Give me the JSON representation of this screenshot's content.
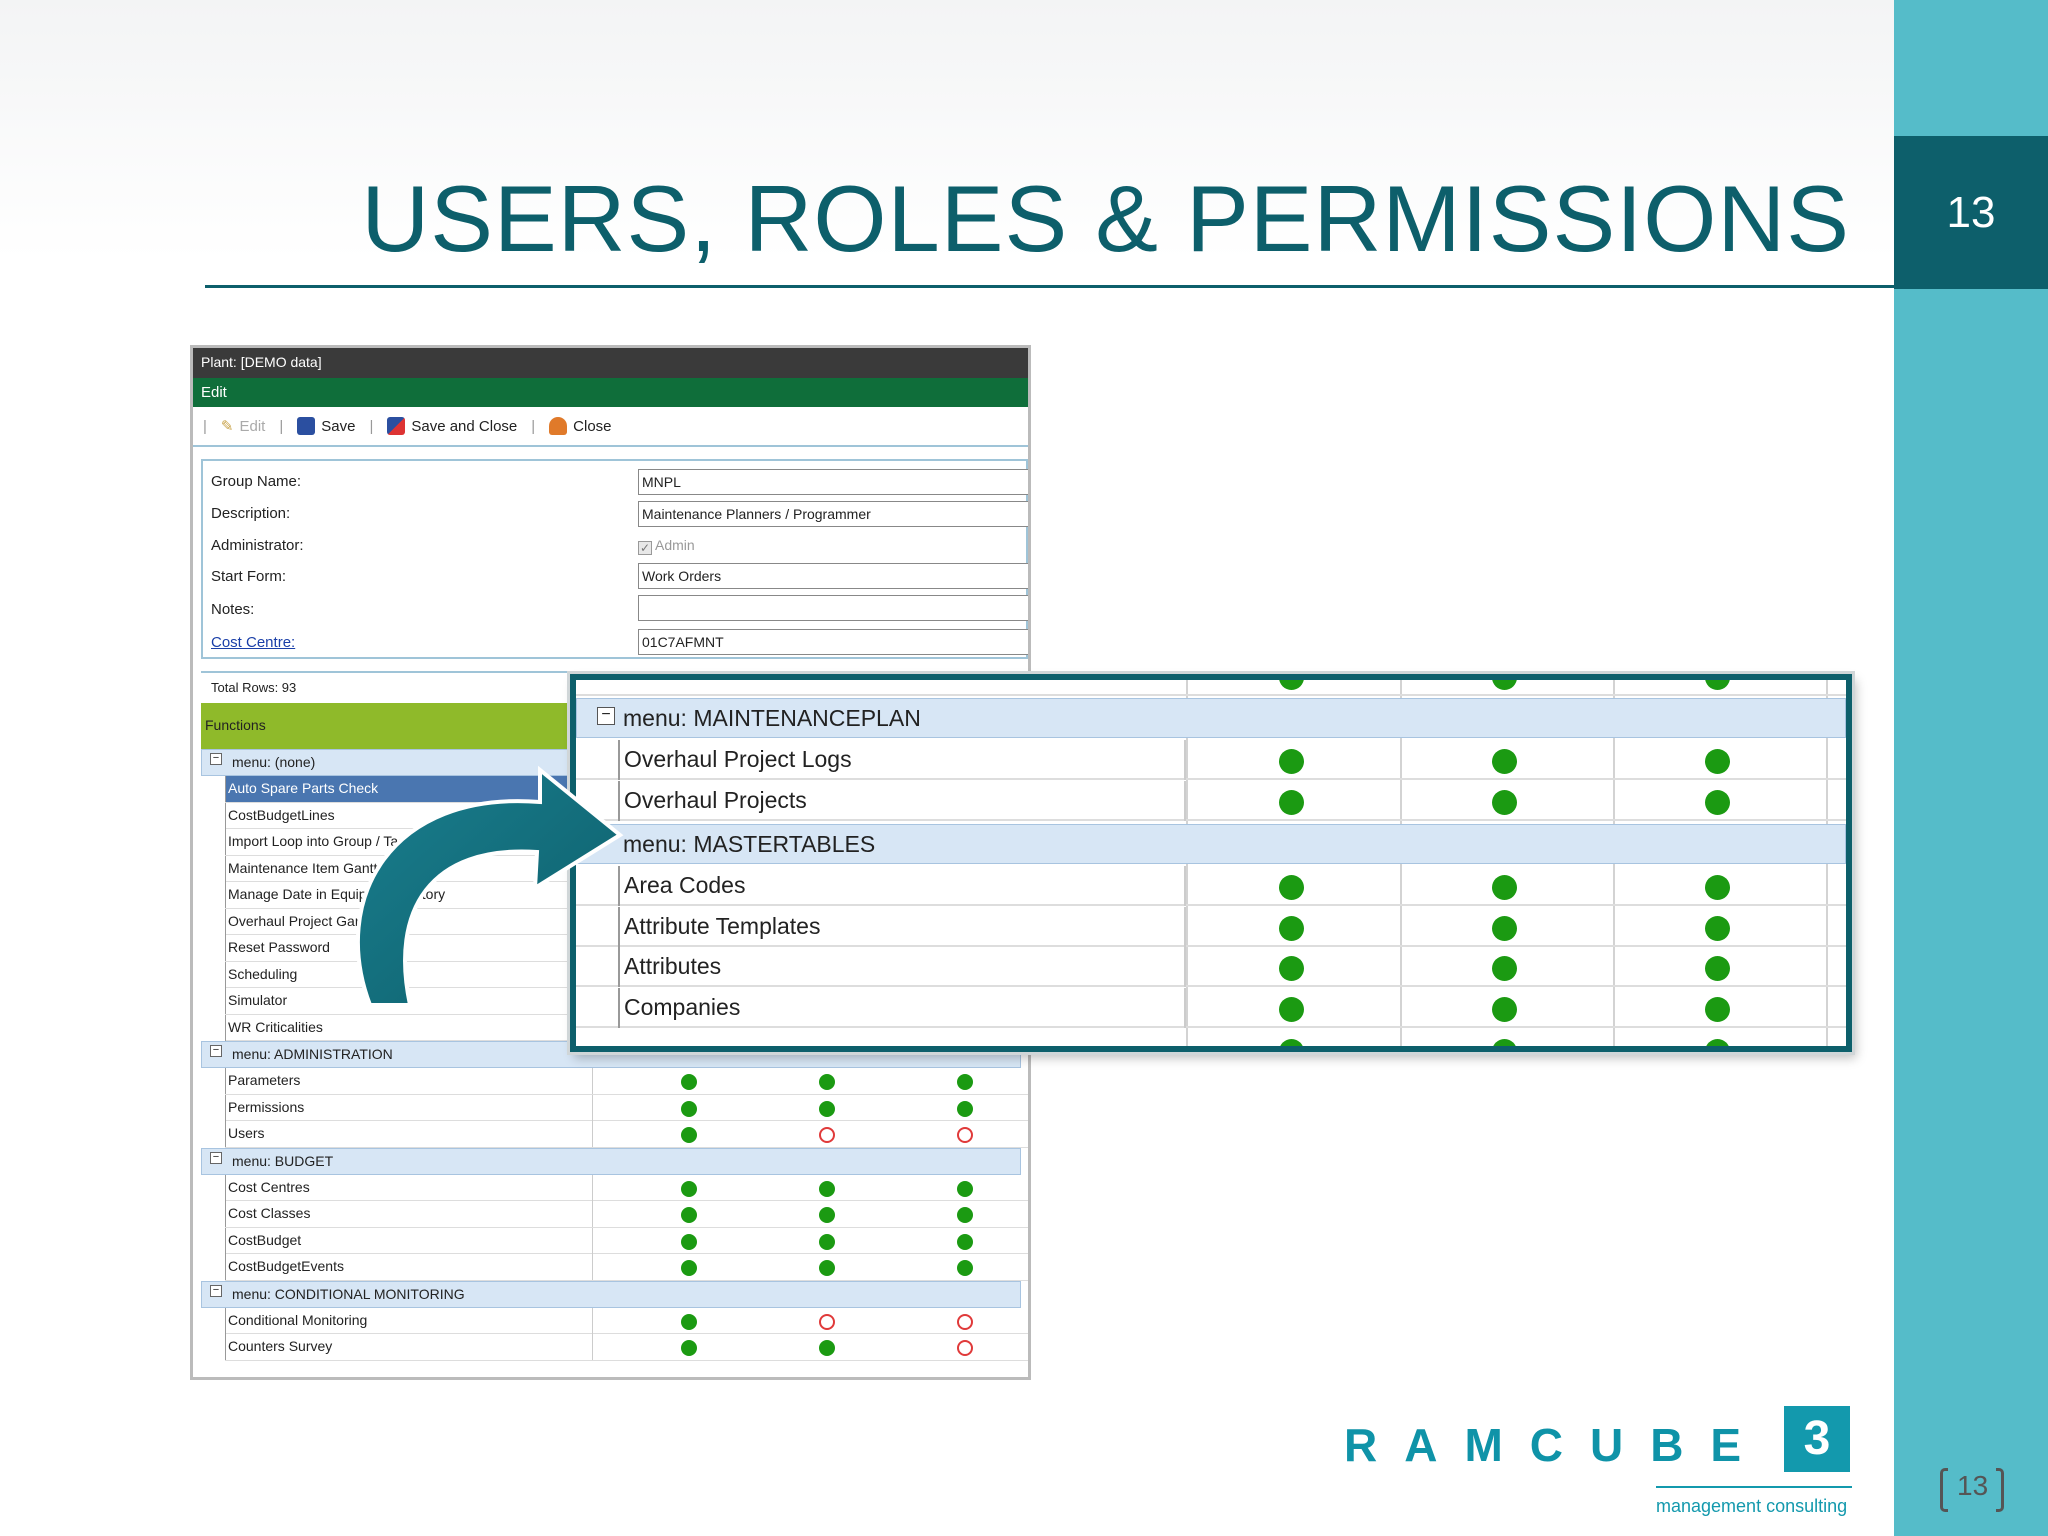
{
  "slide": {
    "title": "USERS, ROLES & PERMISSIONS",
    "page_number": "13",
    "footer_page": "13"
  },
  "logo": {
    "wordmark": "RAMCUBE",
    "mark": "3",
    "tagline": "management consulting"
  },
  "app": {
    "plant_bar": "Plant: [DEMO data]",
    "edit_bar": "Edit",
    "toolbar": {
      "edit": "Edit",
      "save": "Save",
      "save_close": "Save and Close",
      "close": "Close"
    },
    "form": {
      "group_name_label": "Group Name:",
      "group_name_value": "MNPL",
      "description_label": "Description:",
      "description_value": "Maintenance Planners / Programmer",
      "administrator_label": "Administrator:",
      "administrator_value": "Admin",
      "start_form_label": "Start Form:",
      "start_form_value": "Work Orders",
      "notes_label": "Notes:",
      "notes_value": "",
      "cost_centre_label": "Cost Centre:",
      "cost_centre_value": "01C7AFMNT"
    },
    "grid": {
      "total_rows": "Total Rows: 93",
      "functions_header": "Functions",
      "menus": [
        {
          "label": "menu: (none)",
          "rows": [
            {
              "name": "Auto Spare Parts Check",
              "selected": true
            },
            {
              "name": "CostBudgetLines"
            },
            {
              "name": "Import Loop into Group / Tags"
            },
            {
              "name": "Maintenance Item Gantt"
            },
            {
              "name": "Manage Date in Equipment History"
            },
            {
              "name": "Overhaul Project Gantt"
            },
            {
              "name": "Reset Password"
            },
            {
              "name": "Scheduling"
            },
            {
              "name": "Simulator"
            },
            {
              "name": "WR Criticalities"
            }
          ]
        },
        {
          "label": "menu: ADMINISTRATION",
          "rows": [
            {
              "name": "Parameters",
              "perms": [
                true,
                true,
                true
              ]
            },
            {
              "name": "Permissions",
              "perms": [
                true,
                true,
                true
              ]
            },
            {
              "name": "Users",
              "perms": [
                true,
                false,
                false
              ]
            }
          ]
        },
        {
          "label": "menu: BUDGET",
          "rows": [
            {
              "name": "Cost Centres",
              "perms": [
                true,
                true,
                true
              ]
            },
            {
              "name": "Cost Classes",
              "perms": [
                true,
                true,
                true
              ]
            },
            {
              "name": "CostBudget",
              "perms": [
                true,
                true,
                true
              ]
            },
            {
              "name": "CostBudgetEvents",
              "perms": [
                true,
                true,
                true
              ]
            }
          ]
        },
        {
          "label": "menu: CONDITIONAL MONITORING",
          "rows": [
            {
              "name": "Conditional Monitoring",
              "perms": [
                true,
                false,
                false
              ]
            },
            {
              "name": "Counters Survey",
              "perms": [
                true,
                true,
                false
              ]
            }
          ]
        }
      ]
    }
  },
  "zoom": {
    "menu_maintenanceplan": "menu: MAINTENANCEPLAN",
    "menu_mastertables": "menu: MASTERTABLES",
    "maintenance_rows": [
      "Overhaul Project Logs",
      "Overhaul Projects"
    ],
    "master_rows": [
      "Area Codes",
      "Attribute Templates",
      "Attributes",
      "Companies"
    ]
  },
  "colors": {
    "brand_dark": "#0d5f6b",
    "brand_light": "#55bcc9",
    "granted": "#1b9a12",
    "denied": "#e03a3a",
    "functions_header": "#8fba2a"
  }
}
